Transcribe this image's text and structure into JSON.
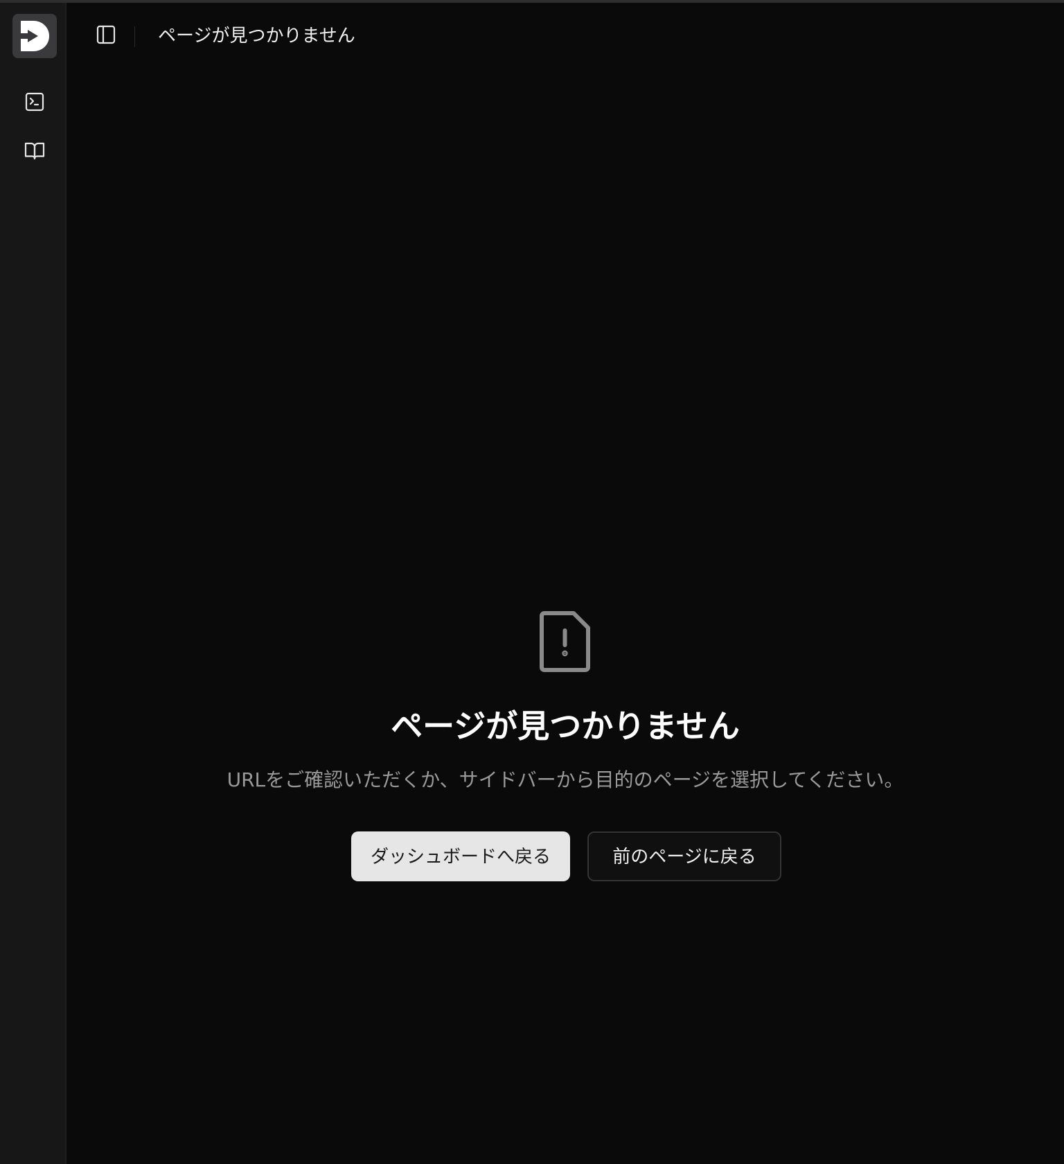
{
  "header": {
    "title": "ページが見つかりません"
  },
  "sidebar": {
    "logo_icon": "app-logo-d-icon",
    "items": [
      {
        "icon": "terminal-icon"
      },
      {
        "icon": "book-open-icon"
      }
    ]
  },
  "not_found": {
    "icon": "file-warning-icon",
    "title": "ページが見つかりません",
    "description": "URLをご確認いただくか、サイドバーから目的のページを選択してください。",
    "primary_button": "ダッシュボードへ戻る",
    "secondary_button": "前のページに戻る"
  },
  "colors": {
    "background": "#0a0a0a",
    "sidebar": "#171717",
    "primary_button_bg": "#e6e6e6",
    "muted_text": "#9a9a9a"
  }
}
